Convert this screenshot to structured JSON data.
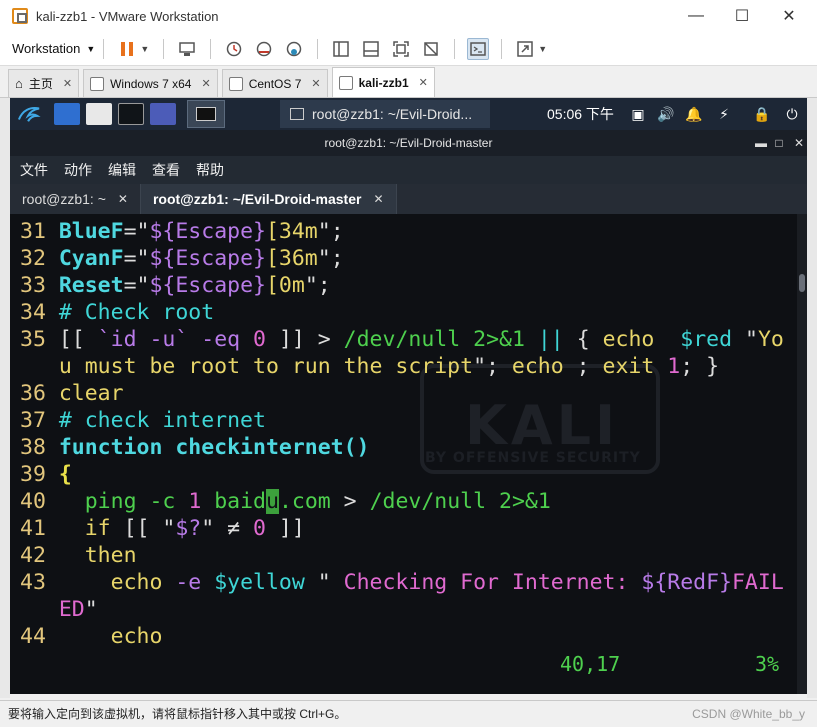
{
  "window": {
    "title": "kali-zzb1 - VMware Workstation"
  },
  "toolbar": {
    "workstation_menu": "Workstation"
  },
  "vm_tabs": [
    {
      "label": "主页",
      "active": false
    },
    {
      "label": "Windows 7 x64",
      "active": false
    },
    {
      "label": "CentOS 7",
      "active": false
    },
    {
      "label": "kali-zzb1",
      "active": true
    }
  ],
  "kali_panel": {
    "window_button": "root@zzb1: ~/Evil-Droid...",
    "clock": "05:06 下午"
  },
  "terminal": {
    "title": "root@zzb1: ~/Evil-Droid-master",
    "menu": [
      "文件",
      "动作",
      "编辑",
      "查看",
      "帮助"
    ],
    "tabs": [
      {
        "label": "root@zzb1: ~",
        "active": false
      },
      {
        "label": "root@zzb1: ~/Evil-Droid-master",
        "active": true
      }
    ],
    "watermark": {
      "logo": "KALI",
      "tagline": "BY OFFENSIVE SECURITY"
    },
    "status": {
      "position": "40,17",
      "percent": "3%"
    }
  },
  "code_lines": [
    {
      "n": "31",
      "segments": [
        [
          "cb",
          "BlueF"
        ],
        [
          "w",
          "=\""
        ],
        [
          "p",
          "${Escape}"
        ],
        [
          "y",
          "[34m"
        ],
        [
          "w",
          "\";"
        ]
      ]
    },
    {
      "n": "32",
      "segments": [
        [
          "cb",
          "CyanF"
        ],
        [
          "w",
          "=\""
        ],
        [
          "p",
          "${Escape}"
        ],
        [
          "y",
          "[36m"
        ],
        [
          "w",
          "\";"
        ]
      ]
    },
    {
      "n": "33",
      "segments": [
        [
          "cb",
          "Reset"
        ],
        [
          "w",
          "=\""
        ],
        [
          "p",
          "${Escape}"
        ],
        [
          "y",
          "[0m"
        ],
        [
          "w",
          "\";"
        ]
      ]
    },
    {
      "n": "34",
      "segments": [
        [
          "c",
          "# Check root"
        ]
      ]
    },
    {
      "n": "35",
      "segments": [
        [
          "w",
          "[[ "
        ],
        [
          "p",
          "`id -u`"
        ],
        [
          "w",
          " "
        ],
        [
          "p",
          "-eq"
        ],
        [
          "w",
          " "
        ],
        [
          "m",
          "0"
        ],
        [
          "w",
          " ]] > "
        ],
        [
          "g",
          "/dev/null"
        ],
        [
          "w",
          " "
        ],
        [
          "g",
          "2>&1"
        ],
        [
          "w",
          " "
        ],
        [
          "c",
          "||"
        ],
        [
          "w",
          " { "
        ],
        [
          "y",
          "echo"
        ],
        [
          "w",
          "  "
        ],
        [
          "c",
          "$red"
        ],
        [
          "w",
          " \""
        ],
        [
          "y",
          "Yo"
        ]
      ]
    },
    {
      "n": "",
      "segments": [
        [
          "y",
          "u must be root to run the script"
        ],
        [
          "w",
          "\"; "
        ],
        [
          "y",
          "echo"
        ],
        [
          "w",
          " ; "
        ],
        [
          "y",
          "exit"
        ],
        [
          "w",
          " "
        ],
        [
          "m",
          "1"
        ],
        [
          "w",
          "; }"
        ]
      ]
    },
    {
      "n": "36",
      "segments": [
        [
          "y",
          "clear"
        ]
      ]
    },
    {
      "n": "37",
      "segments": [
        [
          "c",
          "# check internet"
        ]
      ]
    },
    {
      "n": "38",
      "segments": [
        [
          "cb",
          "function checkinternet()"
        ]
      ]
    },
    {
      "n": "39",
      "segments": [
        [
          "b",
          "{"
        ]
      ]
    },
    {
      "n": "40",
      "segments": [
        [
          "w",
          "  "
        ],
        [
          "g",
          "ping"
        ],
        [
          "w",
          " "
        ],
        [
          "g",
          "-c"
        ],
        [
          "w",
          " "
        ],
        [
          "m",
          "1"
        ],
        [
          "w",
          " "
        ],
        [
          "g",
          "baid"
        ],
        [
          "cursor",
          "u"
        ],
        [
          "g",
          ".com"
        ],
        [
          "w",
          " > "
        ],
        [
          "g",
          "/dev/null"
        ],
        [
          "w",
          " "
        ],
        [
          "g",
          "2>&1"
        ]
      ]
    },
    {
      "n": "41",
      "segments": [
        [
          "w",
          "  "
        ],
        [
          "y",
          "if"
        ],
        [
          "w",
          " [[ \""
        ],
        [
          "p",
          "$?"
        ],
        [
          "w",
          "\" ≠ "
        ],
        [
          "m",
          "0"
        ],
        [
          "w",
          " ]]"
        ]
      ]
    },
    {
      "n": "42",
      "segments": [
        [
          "w",
          "  "
        ],
        [
          "y",
          "then"
        ]
      ]
    },
    {
      "n": "43",
      "segments": [
        [
          "w",
          "    "
        ],
        [
          "y",
          "echo"
        ],
        [
          "w",
          " "
        ],
        [
          "p",
          "-e"
        ],
        [
          "w",
          " "
        ],
        [
          "c",
          "$yellow"
        ],
        [
          "w",
          " \" "
        ],
        [
          "m",
          "Checking For Internet: "
        ],
        [
          "p",
          "${RedF}"
        ],
        [
          "m",
          "FAIL"
        ]
      ]
    },
    {
      "n": "",
      "segments": [
        [
          "m",
          "ED"
        ],
        [
          "w",
          "\""
        ]
      ]
    },
    {
      "n": "44",
      "segments": [
        [
          "w",
          "    "
        ],
        [
          "y",
          "echo"
        ]
      ]
    }
  ],
  "vm_statusbar": {
    "hint": "要将输入定向到该虚拟机，请将鼠标指针移入其中或按 Ctrl+G。",
    "watermark": "CSDN @White_bb_y"
  }
}
